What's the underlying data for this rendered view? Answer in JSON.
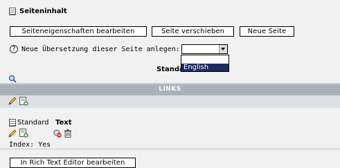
{
  "header": {
    "title": "Seiteninhalt"
  },
  "buttons": {
    "edit_properties": "Seiteneigenschaften bearbeiten",
    "move_page": "Seite verschieben",
    "new_page": "Neue Seite"
  },
  "translation": {
    "help": "?",
    "label": "Neue Übersetzung dieser Seite anlegen:",
    "select_value": "",
    "options": [
      "English"
    ]
  },
  "column": {
    "title": "Standard"
  },
  "links_bar": {
    "label": "LINKS"
  },
  "content_element": {
    "type_prefix": "Standard",
    "type_bold": "Text",
    "index_line": "Index: Yes"
  },
  "rte_button": {
    "label": "In Rich Text Editor bearbeiten"
  },
  "colors": {
    "background": "#f1f1f1",
    "links_bar": "#a9b2bb",
    "pale_bar": "#dde1e5",
    "selected_option": "#1c2b63"
  }
}
